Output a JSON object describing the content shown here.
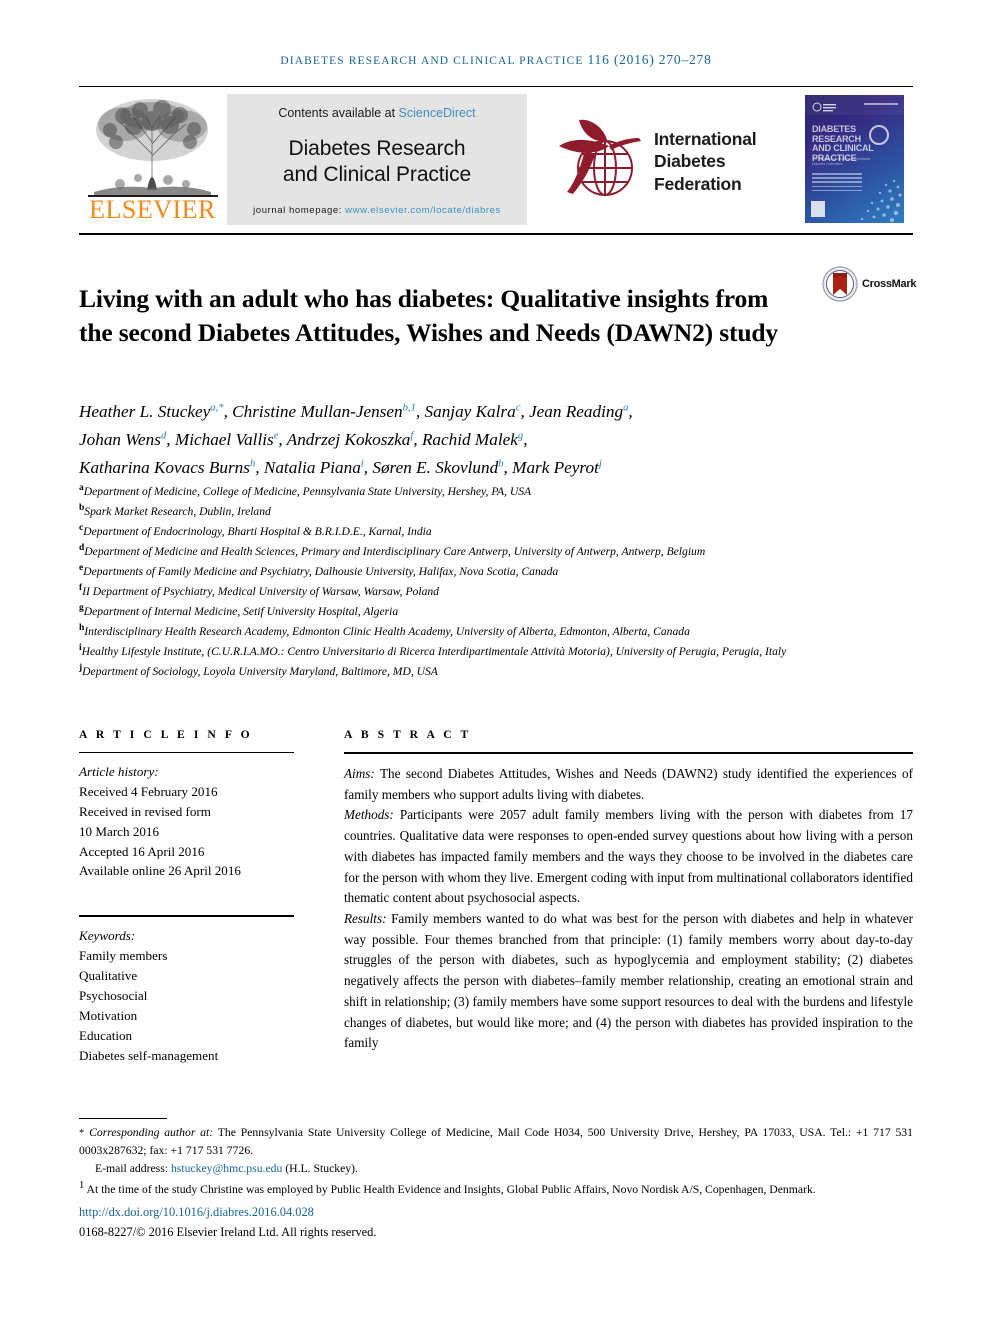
{
  "running_head": {
    "journal": "DIABETES RESEARCH AND CLINICAL PRACTICE",
    "volume_issue": "116 (2016) 270–278"
  },
  "masthead": {
    "contents_prefix": "Contents available at ",
    "sciencedirect": "ScienceDirect",
    "journal_title_line1": "Diabetes Research",
    "journal_title_line2": "and Clinical Practice",
    "homepage_prefix": "journal homepage: ",
    "homepage_url": "www.elsevier.com/locate/diabres",
    "elsevier_wordmark": "ELSEVIER",
    "idf_line1": "International",
    "idf_line2": "Diabetes",
    "idf_line3": "Federation",
    "cover_title": "DIABETES RESEARCH AND CLINICAL PRACTICE",
    "cover_subtitle": "The Official Journal of the International Diabetes Federation",
    "accent_blue": "#3e8fc4",
    "elsevier_orange": "#f08a1e",
    "idf_maroon": "#8f1c2c"
  },
  "article": {
    "title": "Living with an adult who has diabetes: Qualitative insights from the second Diabetes Attitudes, Wishes and Needs (DAWN2) study",
    "crossmark_label": "CrossMark"
  },
  "authors": {
    "line1_parts": [
      {
        "name": "Heather L. Stuckey",
        "sup": "a,*"
      },
      {
        "name": "Christine Mullan-Jensen",
        "sup": "b,1"
      },
      {
        "name": "Sanjay Kalra",
        "sup": "c"
      },
      {
        "name": "Jean Reading",
        "sup": "a"
      }
    ],
    "line2_parts": [
      {
        "name": "Johan Wens",
        "sup": "d"
      },
      {
        "name": "Michael Vallis",
        "sup": "e"
      },
      {
        "name": "Andrzej Kokoszka",
        "sup": "f"
      },
      {
        "name": "Rachid Malek",
        "sup": "g"
      }
    ],
    "line3_parts": [
      {
        "name": "Katharina Kovacs Burns",
        "sup": "h"
      },
      {
        "name": "Natalia Piana",
        "sup": "i"
      },
      {
        "name": "Søren E. Skovlund",
        "sup": "b"
      },
      {
        "name": "Mark Peyrot",
        "sup": "j"
      }
    ]
  },
  "affiliations": [
    {
      "mark": "a",
      "text": "Department of Medicine, College of Medicine, Pennsylvania State University, Hershey, PA, USA"
    },
    {
      "mark": "b",
      "text": "Spark Market Research, Dublin, Ireland"
    },
    {
      "mark": "c",
      "text": "Department of Endocrinology, Bharti Hospital & B.R.I.D.E., Karnal, India"
    },
    {
      "mark": "d",
      "text": "Department of Medicine and Health Sciences, Primary and Interdisciplinary Care Antwerp, University of Antwerp, Antwerp, Belgium"
    },
    {
      "mark": "e",
      "text": "Departments of Family Medicine and Psychiatry, Dalhousie University, Halifax, Nova Scotia, Canada"
    },
    {
      "mark": "f",
      "text": "II Department of Psychiatry, Medical University of Warsaw, Warsaw, Poland"
    },
    {
      "mark": "g",
      "text": "Department of Internal Medicine, Setif University Hospital, Algeria"
    },
    {
      "mark": "h",
      "text": "Interdisciplinary Health Research Academy, Edmonton Clinic Health Academy, University of Alberta, Edmonton, Alberta, Canada"
    },
    {
      "mark": "i",
      "text": "Healthy Lifestyle Institute, (C.U.R.I.A.MO.: Centro Universitario di Ricerca Interdipartimentale Attività Motoria), University of Perugia, Perugia, Italy"
    },
    {
      "mark": "j",
      "text": "Department of Sociology, Loyola University Maryland, Baltimore, MD, USA"
    }
  ],
  "article_info": {
    "heading": "A R T I C L E   I N F O",
    "history_label": "Article history:",
    "history": [
      "Received 4 February 2016",
      "Received in revised form",
      "10 March 2016",
      "Accepted 16 April 2016",
      "Available online 26 April 2016"
    ],
    "keywords_label": "Keywords:",
    "keywords": [
      "Family members",
      "Qualitative",
      "Psychosocial",
      "Motivation",
      "Education",
      "Diabetes self-management"
    ]
  },
  "abstract": {
    "heading": "A B S T R A C T",
    "sections": [
      {
        "label": "Aims:",
        "text": " The second Diabetes Attitudes, Wishes and Needs (DAWN2) study identified the experiences of family members who support adults living with diabetes."
      },
      {
        "label": "Methods:",
        "text": " Participants were 2057 adult family members living with the person with diabetes from 17 countries. Qualitative data were responses to open-ended survey questions about how living with a person with diabetes has impacted family members and the ways they choose to be involved in the diabetes care for the person with whom they live. Emergent coding with input from multinational collaborators identified thematic content about psychosocial aspects."
      },
      {
        "label": "Results:",
        "text": " Family members wanted to do what was best for the person with diabetes and help in whatever way possible. Four themes branched from that principle: (1) family members worry about day-to-day struggles of the person with diabetes, such as hypoglycemia and employment stability; (2) diabetes negatively affects the person with diabetes–family member relationship, creating an emotional strain and shift in relationship; (3) family members have some support resources to deal with the burdens and lifestyle changes of diabetes, but would like more; and (4) the person with diabetes has provided inspiration to the family"
      }
    ]
  },
  "footnotes": {
    "corresponding_label": "Corresponding author at:",
    "corresponding_text": " The Pennsylvania State University College of Medicine, Mail Code H034, 500 University Drive, Hershey, PA 17033, USA. Tel.: +1 717 531 0003x287632; fax: +1 717 531 7726.",
    "email_label": "E-mail address:",
    "email": "hstuckey@hmc.psu.edu",
    "email_suffix": " (H.L. Stuckey).",
    "note1_mark": "1",
    "note1_text": " At the time of the study Christine was employed by Public Health Evidence and Insights, Global Public Affairs, Novo Nordisk A/S, Copenhagen, Denmark.",
    "doi": "http://dx.doi.org/10.1016/j.diabres.2016.04.028",
    "copyright": "0168-8227/© 2016 Elsevier Ireland Ltd. All rights reserved."
  }
}
